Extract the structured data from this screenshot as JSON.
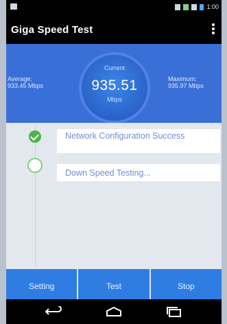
{
  "statusbar": {
    "time": "1:00"
  },
  "app": {
    "title": "Giga Speed Test"
  },
  "gauge": {
    "average_label": "Average:",
    "average_value": "933.45 Mbps",
    "current_label": "Current",
    "current_value": "935.51",
    "current_unit": "Mbps",
    "maximum_label": "Maximum:",
    "maximum_value": "935.97 Mbps"
  },
  "steps": [
    {
      "label": "Network Configuration Success",
      "status": "done"
    },
    {
      "label": "Down Speed Testing...",
      "status": "running"
    }
  ],
  "buttons": {
    "setting": "Setting",
    "test": "Test",
    "stop": "Stop"
  },
  "colors": {
    "accent": "#2f7de2",
    "header": "#3a6fd8",
    "success": "#4db34d"
  },
  "icons": {
    "back": "back-icon",
    "home": "home-icon",
    "recent": "recent-apps-icon",
    "overflow": "overflow-menu-icon"
  }
}
